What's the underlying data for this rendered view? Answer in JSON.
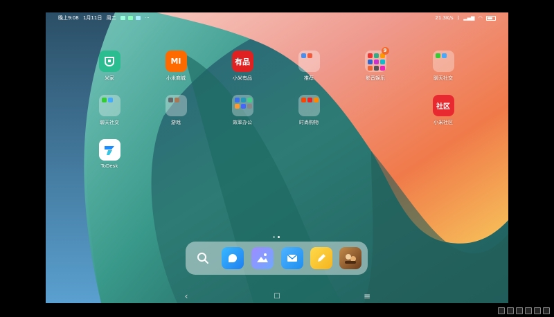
{
  "status": {
    "time": "晚上9:08",
    "date": "1月11日",
    "weekday": "周二",
    "more": "···",
    "net_speed": "21.3K/s"
  },
  "apps": {
    "mijia": {
      "label": "米家"
    },
    "mi_store": {
      "label": "小米商城",
      "glyph": "MI"
    },
    "youpin": {
      "label": "小米有品",
      "glyph": "有品"
    },
    "recommend": {
      "label": "推荐"
    },
    "media": {
      "label": "影音娱乐",
      "badge": "9"
    },
    "social1": {
      "label": "聊天社交"
    },
    "social2": {
      "label": "聊天社交"
    },
    "games": {
      "label": "游戏"
    },
    "office": {
      "label": "效率办公"
    },
    "shopping": {
      "label": "时尚购物"
    },
    "community": {
      "label": "小米社区",
      "glyph": "社区"
    },
    "todesk": {
      "label": "ToDesk"
    }
  },
  "dock": {
    "items": [
      "search",
      "browser",
      "gallery",
      "mail",
      "notes",
      "game"
    ]
  },
  "page_indicator": {
    "pages": 2,
    "current": 2
  },
  "colors": {
    "mijia": "#2bbd8f",
    "mi_store": "#ff6a00",
    "youpin": "#e02121",
    "community": "#e8292f",
    "todesk": "#ffffff",
    "browser": "#2d8cf0",
    "mail": "#2196f3",
    "notes": "#f7c12a"
  },
  "nav": {
    "back": "‹",
    "home": "□",
    "menu": "≡"
  }
}
